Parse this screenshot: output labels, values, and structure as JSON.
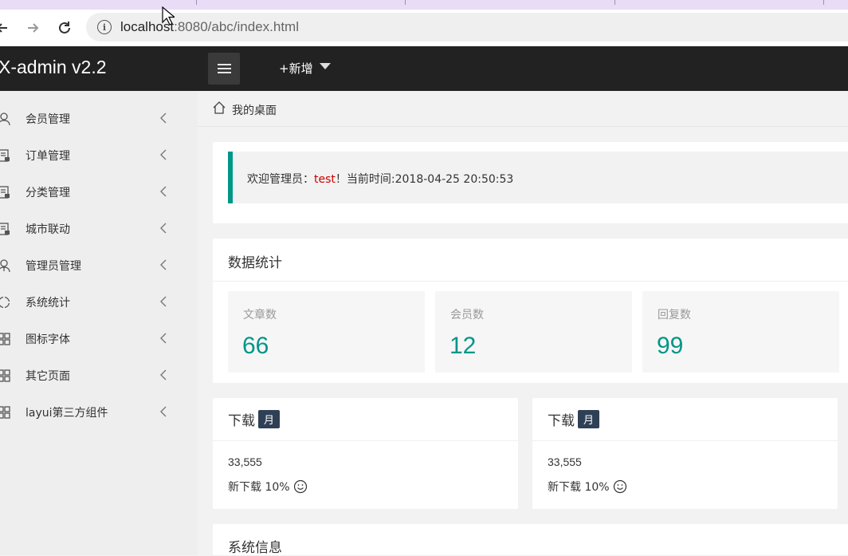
{
  "browser": {
    "url_host": "localhost",
    "url_rest": ":8080/abc/index.html"
  },
  "header": {
    "logo": "X-admin v2.2",
    "add_label": "+新增"
  },
  "sidebar": {
    "items": [
      {
        "label": "会员管理",
        "icon": "user-icon"
      },
      {
        "label": "订单管理",
        "icon": "order-icon"
      },
      {
        "label": "分类管理",
        "icon": "category-icon"
      },
      {
        "label": "城市联动",
        "icon": "city-icon"
      },
      {
        "label": "管理员管理",
        "icon": "admin-icon"
      },
      {
        "label": "系统统计",
        "icon": "stats-icon"
      },
      {
        "label": "图标字体",
        "icon": "grid-icon"
      },
      {
        "label": "其它页面",
        "icon": "grid-icon"
      },
      {
        "label": "layui第三方组件",
        "icon": "grid-icon"
      }
    ]
  },
  "breadcrumb": {
    "label": "我的桌面"
  },
  "welcome": {
    "prefix": "欢迎管理员：",
    "user": "test",
    "suffix": "！当前时间:2018-04-25 20:50:53"
  },
  "stats": {
    "title": "数据统计",
    "items": [
      {
        "label": "文章数",
        "value": "66"
      },
      {
        "label": "会员数",
        "value": "12"
      },
      {
        "label": "回复数",
        "value": "99"
      }
    ]
  },
  "downloads": [
    {
      "title": "下载",
      "badge": "月",
      "value": "33,555",
      "sub": "新下载 10%"
    },
    {
      "title": "下载",
      "badge": "月",
      "value": "33,555",
      "sub": "新下载 10%"
    }
  ],
  "system_info": {
    "title": "系统信息"
  },
  "colors": {
    "accent": "#009688",
    "header": "#222222",
    "badge": "#2f4056",
    "user": "#cc0000"
  }
}
